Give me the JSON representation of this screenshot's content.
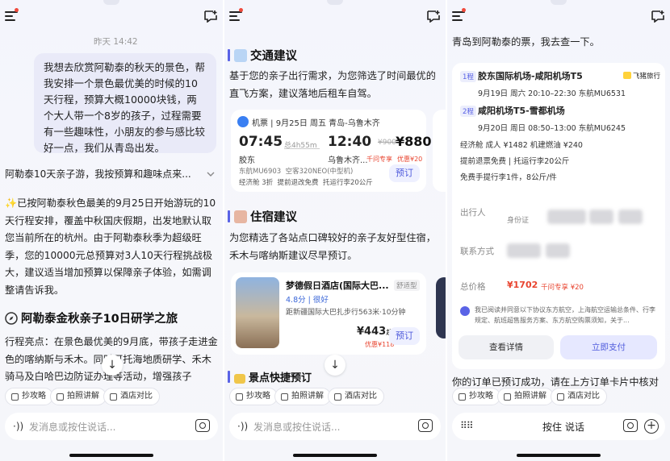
{
  "common": {
    "input_placeholder": "发消息或按住说话...",
    "chips": [
      "抄攻略",
      "拍照讲解",
      "酒店对比"
    ],
    "down_arrow": "↓"
  },
  "p1": {
    "time": "昨天 14:42",
    "user_msg": "我想去欣赏阿勒泰的秋天的景色，帮我安排一个景色最优美的时候的10天行程，预算大概10000块钱，两个大人带一个8岁的孩子，过程需要有一些趣味性，小朋友的参与感比较好一点，我们从青岛出发。",
    "collapsed": "阿勒泰10天亲子游，我按预算和趣味点来...",
    "reply": "✨已按阿勒泰秋色最美的9月25日开始游玩的10天行程安排，覆盖中秋国庆假期，出发地默认取您当前所在的杭州。由于阿勒泰秋季为超级旺季，您的10000元总预算对3人10天行程挑战极大，建议适当增加预算以保障亲子体验，如需调整请告诉我。",
    "title": "阿勒泰金秋亲子10日研学之旅",
    "highlights": "行程亮点：在景色最优美的9月底，带孩子走进金色的喀纳斯与禾木。同时可托海地质研学、禾木骑马及白哈巴边防证办理等活动，增强孩子"
  },
  "p2": {
    "transport_title": "交通建议",
    "transport_desc": "基于您的亲子出行需求，为您筛选了时间最优的直飞方案，建议落地后租车自驾。",
    "ticket": {
      "type_date": "机票 | 9月25日 周五 青岛-乌鲁木齐",
      "dep_time": "07:45",
      "duration": "总4h55m",
      "arr_time": "12:40",
      "dep_airport": "胶东",
      "arr_airport": "乌鲁木齐...",
      "orig_price": "¥900",
      "price": "¥880",
      "tag1": "千问专享",
      "tag2": "优惠¥20",
      "airline": "东航MU6903",
      "plane": "空客320NEO(中型机)",
      "cabin": "经济舱 3折",
      "refund": "提前退改免费",
      "baggage": "托运行李20公斤",
      "book": "预订"
    },
    "hotel_title": "住宿建议",
    "hotel_desc": "为您精选了各站点口碑较好的亲子友好型住宿，禾木与喀纳斯建议尽早预订。",
    "hotel": {
      "name": "梦德假日酒店(国际大巴...",
      "type": "舒适型",
      "score": "4.8分",
      "score_label": "很好",
      "location": "距新疆国际大巴扎步行563米·10分钟",
      "price": "¥443",
      "price_suffix": "起",
      "discount": "优惠¥118",
      "book": "预订"
    },
    "scenic_title": "景点快捷预订"
  },
  "p3": {
    "top_text": "青岛到阿勒泰的票，我去查一下。",
    "leg1_tag": "1程",
    "leg1_route": "胶东国际机场-咸阳机场T5",
    "brand": "飞猪旅行",
    "leg1_detail": "9月19日 周六 20:10–22:30   东航MU6531",
    "leg2_tag": "2程",
    "leg2_route": "咸阳机场T5-雪都机场",
    "leg2_detail": "9月20日 周日 08:50–13:00   东航MU6245",
    "cabin_info": "经济舱   成人 ¥1482  机建燃油 ¥240",
    "policy": "提前退票免费 | 托运行李20公斤",
    "free_bag": "免费手提行李1件，8公斤/件",
    "traveler_label": "出行人",
    "id_label": "身份证",
    "contact_label": "联系方式",
    "total_label": "总价格",
    "total_price": "¥1702",
    "total_tag": "千问专享 ¥20",
    "agree": "我已阅读并同意以下协议东方航空，上海航空运输总条件、行李规定、航班超售服务方案、东方航空购票须知，关于...",
    "detail_btn": "查看详情",
    "pay_btn": "立即支付",
    "bottom_text": "你的订单已预订成功，请在上方订单卡片中核对",
    "voice": "按住 说话"
  }
}
